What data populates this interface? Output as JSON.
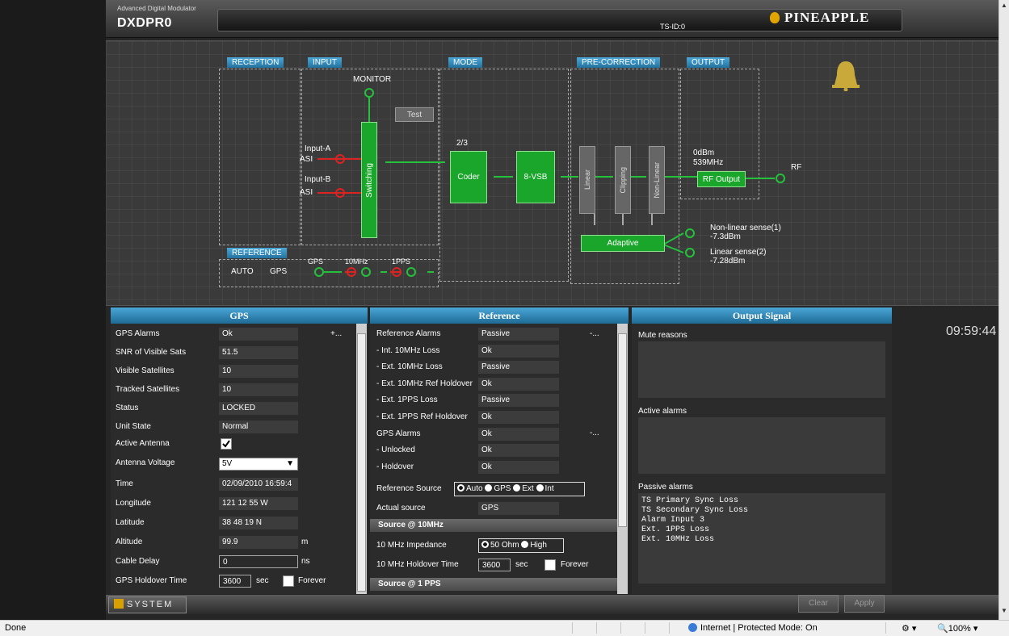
{
  "header": {
    "subtitle": "Advanced Digital Modulator",
    "device": "DXDPR0",
    "ts_id": "TS-ID:0",
    "brand": "PINEAPPLE"
  },
  "diagram": {
    "sections": {
      "reception": "RECEPTION",
      "input": "INPUT",
      "mode": "MODE",
      "precorrection": "PRE-CORRECTION",
      "output": "OUTPUT",
      "reference": "REFERENCE"
    },
    "monitor": "MONITOR",
    "test": "Test",
    "input_a": "Input-A",
    "input_a_type": "ASI",
    "input_b": "Input-B",
    "input_b_type": "ASI",
    "switching": "Switching",
    "rate": "2/3",
    "coder": "Coder",
    "vsb": "8-VSB",
    "linear": "Linear",
    "clipping": "Clipping",
    "nonlinear": "Non-Linear",
    "adaptive": "Adaptive",
    "power": "0dBm",
    "freq": "539MHz",
    "rf_output": "RF Output",
    "rf": "RF",
    "nl_sense": "Non-linear sense(1)",
    "nl_sense_val": "-7.3dBm",
    "l_sense": "Linear sense(2)",
    "l_sense_val": "-7.28dBm",
    "ref_auto": "AUTO",
    "ref_gps": "GPS",
    "gps": "GPS",
    "ref_10mhz": "10MHz",
    "ref_1pps": "1PPS",
    "clock": "09:59:44"
  },
  "gps": {
    "title": "GPS",
    "more": "+...",
    "rows": [
      {
        "label": "GPS Alarms",
        "value": "Ok"
      },
      {
        "label": "SNR of Visible Sats",
        "value": "51.5"
      },
      {
        "label": "Visible Satellites",
        "value": "10"
      },
      {
        "label": "Tracked Satellites",
        "value": "10"
      },
      {
        "label": "Status",
        "value": "LOCKED"
      },
      {
        "label": "Unit State",
        "value": "Normal"
      }
    ],
    "active_antenna": "Active Antenna",
    "antenna_voltage": "Antenna Voltage",
    "antenna_voltage_value": "5V",
    "rows2": [
      {
        "label": "Time",
        "value": "02/09/2010 16:59:4"
      },
      {
        "label": "Longitude",
        "value": "121 12 55 W"
      },
      {
        "label": "Latitude",
        "value": "38 48 19 N"
      }
    ],
    "altitude": "Altitude",
    "altitude_value": "99.9",
    "altitude_unit": "m",
    "cable_delay": "Cable Delay",
    "cable_delay_value": "0",
    "cable_delay_unit": "ns",
    "holdover": "GPS Holdover Time",
    "holdover_value": "3600",
    "holdover_unit": "sec",
    "forever": "Forever"
  },
  "reference": {
    "title": "Reference",
    "more1": "-...",
    "more2": "-...",
    "rows": [
      {
        "label": "Reference Alarms",
        "value": "Passive"
      },
      {
        "label": "- Int. 10MHz Loss",
        "value": "Ok"
      },
      {
        "label": "- Ext. 10MHz Loss",
        "value": "Passive"
      },
      {
        "label": "- Ext. 10MHz Ref Holdover",
        "value": "Ok"
      },
      {
        "label": "- Ext. 1PPS Loss",
        "value": "Passive"
      },
      {
        "label": "- Ext. 1PPS Ref Holdover",
        "value": "Ok"
      },
      {
        "label": "GPS Alarms",
        "value": "Ok"
      },
      {
        "label": "- Unlocked",
        "value": "Ok"
      },
      {
        "label": "- Holdover",
        "value": "Ok"
      }
    ],
    "source_label": "Reference Source",
    "source_opts": [
      "Auto",
      "GPS",
      "Ext",
      "Int"
    ],
    "actual_label": "Actual source",
    "actual_value": "GPS",
    "sub_10mhz": "Source @ 10MHz",
    "impedance_label": "10 MHz Impedance",
    "imp_opts": [
      "50 Ohm",
      "High"
    ],
    "holdover_label": "10 MHz Holdover Time",
    "holdover_value": "3600",
    "holdover_unit": "sec",
    "forever": "Forever",
    "sub_1pps": "Source @ 1 PPS"
  },
  "output": {
    "title": "Output Signal",
    "mute": "Mute reasons",
    "active": "Active alarms",
    "passive": "Passive alarms",
    "passive_list": [
      "TS Primary Sync Loss",
      "TS Secondary Sync Loss",
      "Alarm Input 3",
      "Ext. 1PPS Loss",
      "Ext. 10MHz Loss"
    ]
  },
  "bottom": {
    "system": "SYSTEM",
    "clear": "Clear",
    "apply": "Apply"
  },
  "status": {
    "left": "Done",
    "zone": "Internet | Protected Mode: On",
    "zoom": "100%"
  }
}
